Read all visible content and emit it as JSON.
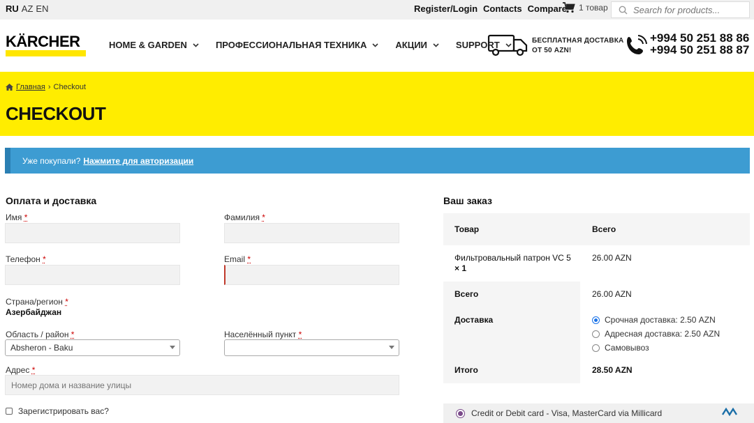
{
  "topbar": {
    "languages": [
      {
        "code": "RU",
        "active": true
      },
      {
        "code": "AZ",
        "active": false
      },
      {
        "code": "EN",
        "active": false
      }
    ],
    "links": [
      "Register/Login",
      "Contacts",
      "Compare"
    ],
    "cart_count": "1 товар",
    "search_placeholder": "Search for products..."
  },
  "header": {
    "logo_text": "KÄRCHER",
    "nav": [
      "HOME & GARDEN",
      "ПРОФЕССИОНАЛЬНАЯ ТЕХНИКА",
      "АКЦИИ",
      "SUPPORT"
    ],
    "free_shipping_line1": "БЕСПЛАТНАЯ ДОСТАВКА",
    "free_shipping_line2": "ОТ 50 AZN!",
    "phone1": "+994 50 251 88 86",
    "phone2": "+994 50 251 88 87"
  },
  "breadcrumb": {
    "home": "Главная",
    "separator": "›",
    "current": "Checkout"
  },
  "page_title": "CHECKOUT",
  "notice": {
    "text": "Уже покупали?",
    "link": "Нажмите для авторизации"
  },
  "billing": {
    "title": "Оплата и доставка",
    "first_name_label": "Имя",
    "last_name_label": "Фамилия",
    "phone_label": "Телефон",
    "email_label": "Email",
    "country_label": "Страна/регион",
    "country_value": "Азербайджан",
    "region_label": "Область / район",
    "region_value": "Absheron - Baku",
    "city_label": "Населённый пункт",
    "city_value": "",
    "address_label": "Адрес",
    "address_placeholder": "Номер дома и название улицы",
    "register_label": "Зарегистрировать вас?",
    "required_mark": "*"
  },
  "order": {
    "title": "Ваш заказ",
    "col_product": "Товар",
    "col_total": "Всего",
    "item_name": "Фильтровальный патрон VC 5",
    "item_qty": "× 1",
    "item_price": "26.00 AZN",
    "subtotal_label": "Всего",
    "subtotal_value": "26.00 AZN",
    "shipping_label": "Доставка",
    "shipping_options": [
      {
        "label": "Срочная доставка: 2.50 AZN",
        "selected": true
      },
      {
        "label": "Адресная доставка: 2.50 AZN",
        "selected": false
      },
      {
        "label": "Самовывоз",
        "selected": false
      }
    ],
    "total_label": "Итого",
    "total_value": "28.50 AZN"
  },
  "payment": {
    "method": "Credit or Debit card - Visa, MasterCard via Millicard",
    "logo_text": "millikart"
  },
  "colors": {
    "brand_yellow": "#ffed00",
    "notice_blue": "#3d9cd2",
    "required_red": "#cc0000"
  }
}
